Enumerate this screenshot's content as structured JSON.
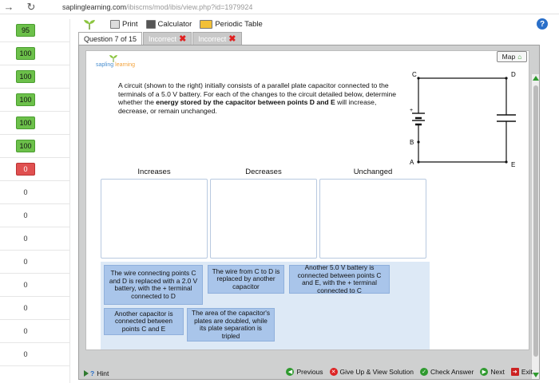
{
  "browser": {
    "url_host": "saplinglearning.com",
    "url_path": "/ibiscms/mod/ibis/view.php?id=1979924"
  },
  "scores": [
    "95",
    "100",
    "100",
    "100",
    "100",
    "100",
    "0",
    "0",
    "0",
    "0",
    "0",
    "0",
    "0",
    "0",
    "0"
  ],
  "score_colors": {
    "green": "#6cc04a",
    "red": "#e05050"
  },
  "toolbar": {
    "print": "Print",
    "calculator": "Calculator",
    "periodic_table": "Periodic Table",
    "help": "?"
  },
  "tabs": {
    "question": "Question 7 of 15",
    "incorrect1": "Incorrect",
    "incorrect2": "Incorrect"
  },
  "logo": {
    "sapling": "sapling",
    "learning": "learning"
  },
  "map_button": "Map",
  "question_text_1": "A circuit (shown to the right) initially consists of a parallel plate capacitor connected to the terminals of a 5.0 V battery. For each of the changes to the circuit detailed below, determine whether the ",
  "question_text_bold": "energy stored by the capacitor between points D and E",
  "question_text_2": " will increase, decrease, or remain unchanged.",
  "circuit_labels": {
    "c": "C",
    "d": "D",
    "b": "B",
    "a": "A",
    "e": "E",
    "plus": "+"
  },
  "bins": {
    "increases": "Increases",
    "decreases": "Decreases",
    "unchanged": "Unchanged"
  },
  "cards": [
    "The wire connecting points C and D is replaced with a 2.0 V battery, with the + terminal connected to D",
    "The wire from C to D is replaced by another capacitor",
    "Another 5.0 V battery is connected between points C and E, with the + terminal connected to C",
    "Another capacitor is connected between points C and E",
    "The area of the capacitor's plates are doubled, while its plate separation is tripled"
  ],
  "bottom": {
    "hint": "Hint",
    "previous": "Previous",
    "give_up": "Give Up & View Solution",
    "check": "Check Answer",
    "next": "Next",
    "exit": "Exit"
  }
}
